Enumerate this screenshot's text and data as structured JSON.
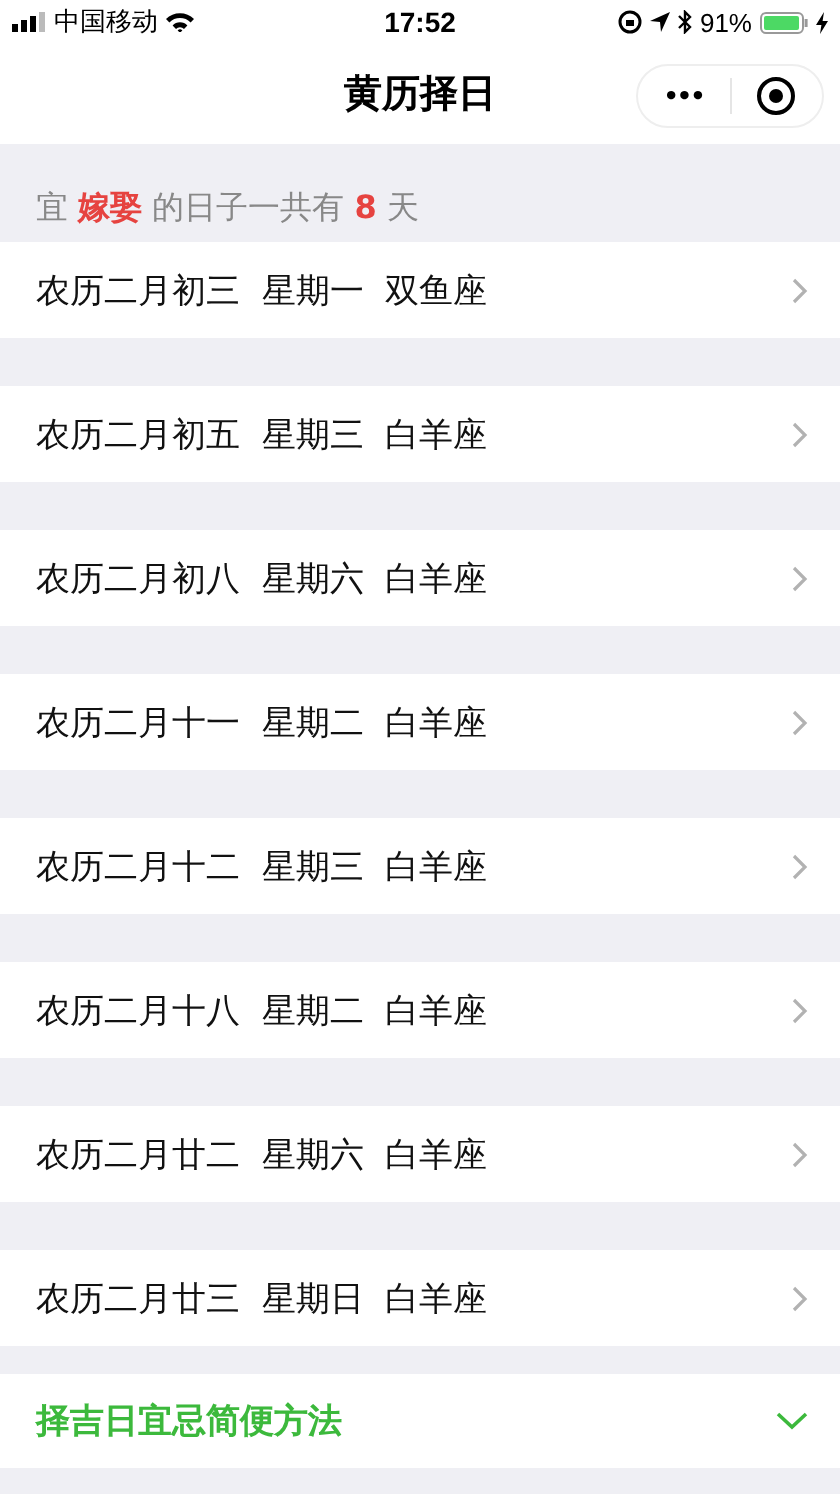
{
  "status_bar": {
    "carrier": "中国移动",
    "time": "17:52",
    "battery": "91%"
  },
  "nav": {
    "title": "黄历择日",
    "more": "•••"
  },
  "summary": "宜 **嫁娶** 的日子一共有 **8** 天",
  "days": [
    {
      "label": "农历二月初三  星期一  双鱼座"
    },
    {
      "label": "农历二月初五  星期三  白羊座"
    },
    {
      "label": "农历二月初八  星期六  白羊座"
    },
    {
      "label": "农历二月十一  星期二  白羊座"
    },
    {
      "label": "农历二月十二  星期三  白羊座"
    },
    {
      "label": "农历二月十八  星期二  白羊座"
    },
    {
      "label": "农历二月廿二  星期六  白羊座"
    },
    {
      "label": "农历二月廿三  星期日  白羊座"
    }
  ],
  "tips": {
    "label": "择吉日宜忌简便方法",
    "expanded": false
  }
}
